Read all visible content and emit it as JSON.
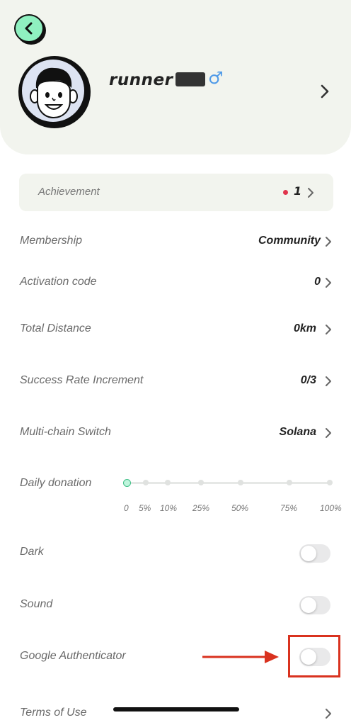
{
  "profile": {
    "username": "runner",
    "gender_symbol": "♂"
  },
  "achievement": {
    "label": "Achievement",
    "count": "1"
  },
  "rows": {
    "membership": {
      "label": "Membership",
      "value": "Community"
    },
    "activation_code": {
      "label": "Activation code",
      "value": "0"
    },
    "total_distance": {
      "label": "Total Distance",
      "value": "0km"
    },
    "success_rate": {
      "label": "Success Rate Increment",
      "value": "0/3"
    },
    "multichain": {
      "label": "Multi-chain Switch",
      "value": "Solana"
    }
  },
  "donation": {
    "label": "Daily donation",
    "ticks": [
      "0",
      "5%",
      "10%",
      "25%",
      "50%",
      "75%",
      "100%"
    ],
    "selected": "0"
  },
  "toggles": {
    "dark": {
      "label": "Dark",
      "on": false
    },
    "sound": {
      "label": "Sound",
      "on": false
    },
    "google_auth": {
      "label": "Google Authenticator",
      "on": false
    }
  },
  "terms": {
    "label": "Terms of Use"
  },
  "colors": {
    "header_bg": "#f2f4ee",
    "back_button": "#8ff0c0",
    "accent_green": "#3fbf86",
    "badge_dot": "#e0344c",
    "highlight": "#d9321f",
    "gender": "#4f9ae8"
  }
}
